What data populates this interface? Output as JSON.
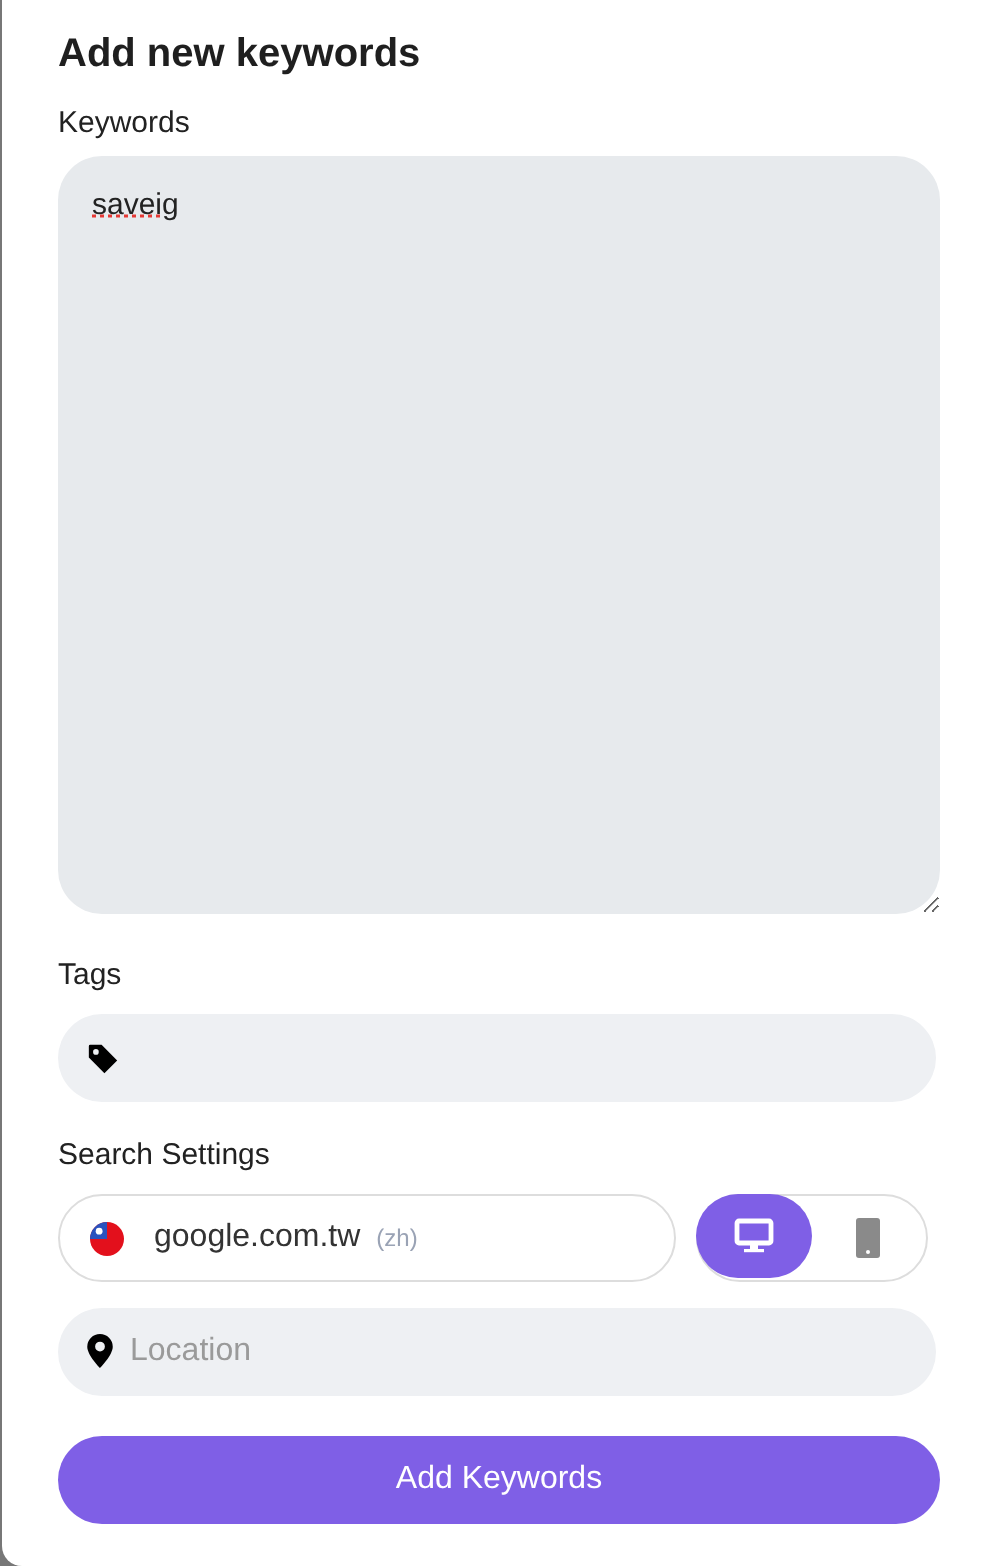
{
  "title": "Add new keywords",
  "keywords": {
    "label": "Keywords",
    "value": "saveig"
  },
  "tags": {
    "label": "Tags"
  },
  "search_settings": {
    "label": "Search Settings",
    "domain": "google.com.tw",
    "language": "(zh)",
    "devices": [
      {
        "kind": "desktop",
        "selected": true
      },
      {
        "kind": "mobile",
        "selected": false
      }
    ],
    "location": {
      "placeholder": "Location"
    }
  },
  "submit": "Add Keywords"
}
